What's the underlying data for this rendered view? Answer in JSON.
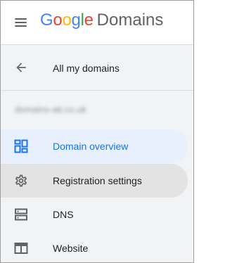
{
  "header": {
    "logo": {
      "letters": [
        {
          "char": "G",
          "color": "#4285F4"
        },
        {
          "char": "o",
          "color": "#EA4335"
        },
        {
          "char": "o",
          "color": "#FBBC05"
        },
        {
          "char": "g",
          "color": "#4285F4"
        },
        {
          "char": "l",
          "color": "#34A853"
        },
        {
          "char": "e",
          "color": "#EA4335"
        }
      ],
      "product": "Domains"
    },
    "menu_icon": "hamburger-menu-icon"
  },
  "sidebar": {
    "back": {
      "icon": "arrow-back-icon",
      "label": "All my domains"
    },
    "domain_name": "domains-ati.co.uk",
    "items": [
      {
        "label": "Domain overview",
        "icon": "dashboard-icon",
        "state": "selected",
        "color": "#1a73e8"
      },
      {
        "label": "Registration settings",
        "icon": "gear-icon",
        "state": "hovered"
      },
      {
        "label": "DNS",
        "icon": "dns-icon",
        "state": "normal"
      },
      {
        "label": "Website",
        "icon": "website-icon",
        "state": "normal"
      }
    ]
  },
  "colors": {
    "accent": "#1a73e8",
    "selected_bg": "#e8f0fe",
    "hover_bg": "#e3e3e3",
    "sidebar_bg": "#f1f3f4",
    "icon_gray": "#5f6368"
  }
}
